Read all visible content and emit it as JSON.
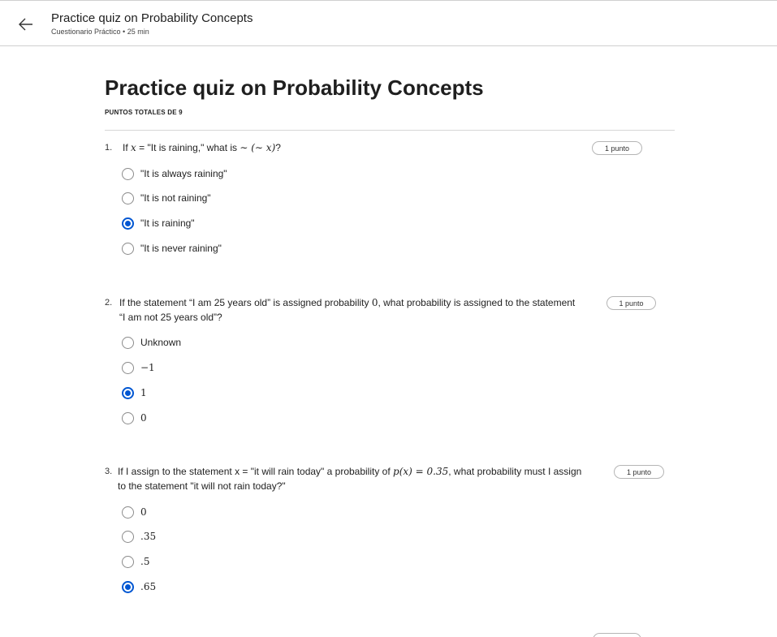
{
  "header": {
    "title": "Practice quiz on Probability Concepts",
    "subtitle": "Cuestionario Práctico • 25 min"
  },
  "page": {
    "title": "Practice quiz on Probability Concepts",
    "total_points": "PUNTOS TOTALES DE 9"
  },
  "questions": [
    {
      "number": "1.",
      "text_a": "If ",
      "math_a": "x",
      "text_b": " = \"It is raining,\" what is ",
      "math_b": "∼ (∼ x)",
      "text_c": "?",
      "points": "1 punto",
      "options": [
        {
          "label": "\"It is always raining\"",
          "selected": false
        },
        {
          "label": "\"It is not raining\"",
          "selected": false
        },
        {
          "label": "\"It is raining\"",
          "selected": true
        },
        {
          "label": "\"It is never raining\"",
          "selected": false
        }
      ]
    },
    {
      "number": "2.",
      "text_a": "If the statement “I am 25 years old” is assigned probability ",
      "math_a": "0",
      "text_b": ", what probability is assigned to the statement",
      "text_line2": "“I am not 25 years old”?",
      "points": "1 punto",
      "options": [
        {
          "label": "Unknown",
          "selected": false
        },
        {
          "label": "−1",
          "selected": false
        },
        {
          "label": "1",
          "selected": true
        },
        {
          "label": "0",
          "selected": false
        }
      ]
    },
    {
      "number": "3.",
      "text_a": "If I assign to the statement x = \"it will rain today\" a probability of ",
      "math_a": "p(x) = 0.35",
      "text_b": ", what probability must I assign",
      "text_line2": "to the statement \"it will not rain today?\"",
      "points": "1 punto",
      "options": [
        {
          "label": "0",
          "selected": false
        },
        {
          "label": ".35",
          "selected": false
        },
        {
          "label": ".5",
          "selected": false
        },
        {
          "label": ".65",
          "selected": true
        }
      ]
    }
  ],
  "colors": {
    "accent": "#0056d2",
    "border": "#d0d0d0",
    "text": "#1f1f1f"
  },
  "icons": {
    "back": "arrow-left-icon",
    "radio": "radio-button-icon"
  }
}
